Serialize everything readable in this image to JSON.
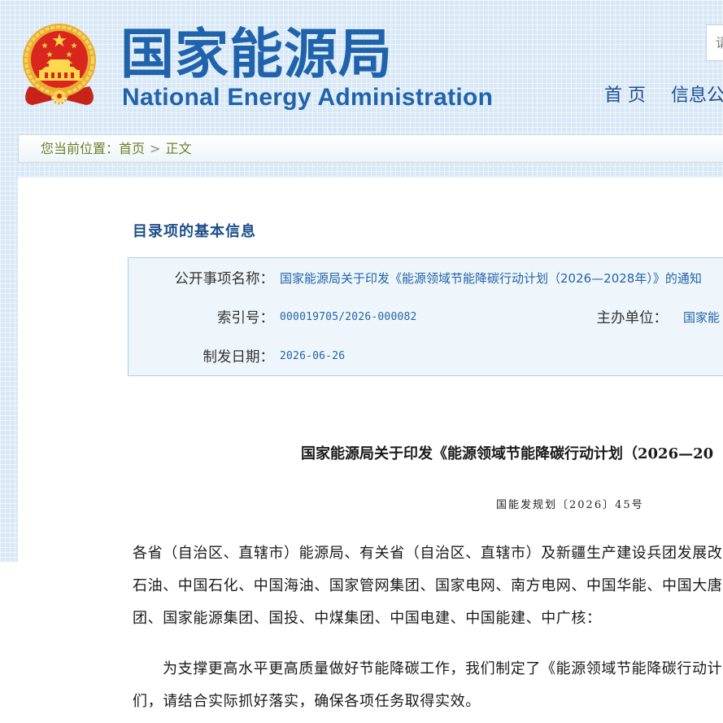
{
  "colors": {
    "brand_blue": "#1f63ad",
    "nav_blue": "#1d4f91",
    "breadcrumb_olive": "#707f2c",
    "heading_blue": "#1f4f8a",
    "value_blue": "#2263a9",
    "info_bg": "#eef6fb",
    "info_border": "#a9d2e6",
    "grid_bg": "#d8e8f6"
  },
  "header": {
    "site_title": "国家能源局",
    "site_subtitle": "National Energy Administration",
    "search_placeholder": "请",
    "nav": [
      {
        "label": "首 页"
      },
      {
        "label": "信息公"
      }
    ]
  },
  "breadcrumb": {
    "prefix": "您当前位置：",
    "home": "首页",
    "separator": ">",
    "current": "正文"
  },
  "catalog_info": {
    "heading": "目录项的基本信息",
    "title_label": "公开事项名称：",
    "title_value": "国家能源局关于印发《能源领域节能降碳行动计划（2026—2028年）》的通知",
    "index_label": "索引号：",
    "index_value": "000019705/2026-000082",
    "issuer_label": "主办单位：",
    "issuer_value": "国家能",
    "date_label": "制发日期：",
    "date_value": "2026-06-26"
  },
  "document": {
    "title": "国家能源局关于印发《能源领域节能降碳行动计划（2026—20",
    "doc_number": "国能发规划〔2026〕45号",
    "paragraphs": [
      {
        "lines": [
          "各省（自治区、直辖市）能源局、有关省（自治区、直辖市）及新疆生产建设兵团发展改",
          "石油、中国石化、中国海油、国家管网集团、国家电网、南方电网、中国华能、中国大唐",
          "团、国家能源集团、国投、中煤集团、中国电建、中国能建、中广核："
        ]
      },
      {
        "lines": [
          "为支撑更高水平更高质量做好节能降碳工作，我们制定了《能源领域节能降碳行动计",
          "们，请结合实际抓好落实，确保各项任务取得实效。"
        ]
      }
    ]
  }
}
